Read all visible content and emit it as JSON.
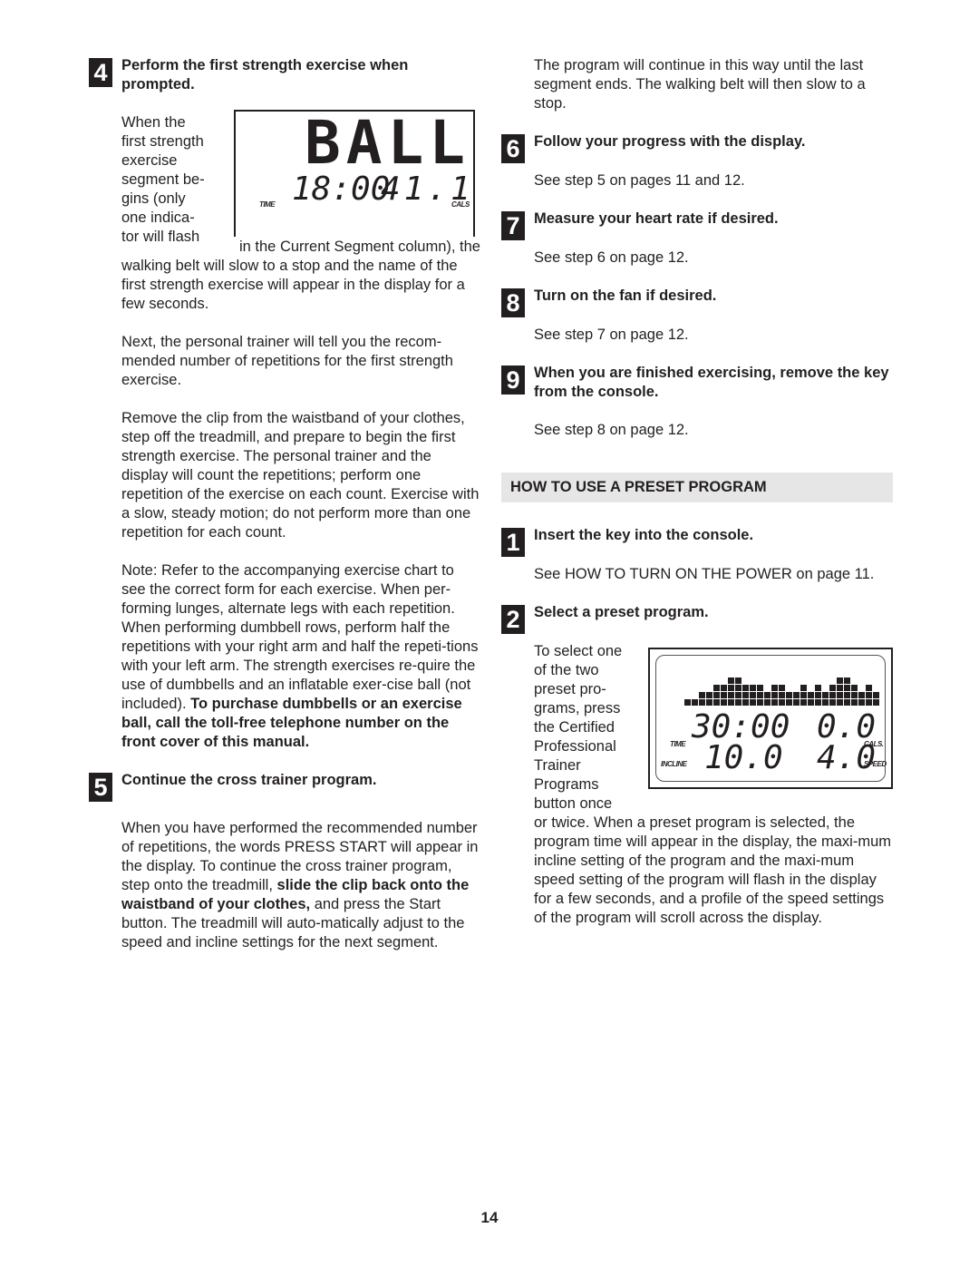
{
  "page_number": "14",
  "left": {
    "step4": {
      "num": "4",
      "heading": "Perform the first strength exercise when prompted.",
      "intro_lines": [
        "When the",
        "first strength",
        "exercise",
        "segment be-",
        "gins (only",
        "one indica-",
        "tor will flash"
      ],
      "intro_rest": "in the Current Segment column), the walking belt will slow to a stop and the name of the first strength exercise will appear in the display for a few seconds.",
      "para2": "Next, the personal trainer will tell you the recom-mended number of repetitions for the first strength exercise.",
      "para3": "Remove the clip from the waistband of your clothes, step off the treadmill, and prepare to begin the first strength exercise. The personal trainer and the display will count the repetitions; perform one repetition of the exercise on each count. Exercise with a slow, steady motion; do not perform more than one repetition for each count.",
      "para4_normal": "Note: Refer to the accompanying exercise chart to see the correct form for each exercise. When per-forming lunges, alternate legs with each repetition. When performing dumbbell rows, perform half the repetitions with your right arm and half the repeti-tions with your left arm. The strength exercises re-quire the use of dumbbells and an inflatable exer-cise ball (not included). ",
      "para4_bold": "To purchase dumbbells or an exercise ball, call the toll-free telephone number on the front cover of this manual.",
      "display": {
        "word": "BALL",
        "time": "18:00",
        "cals": "41.1",
        "time_label": "TIME",
        "cals_label": "CALS"
      }
    },
    "step5": {
      "num": "5",
      "heading": "Continue the cross trainer program.",
      "para_a": "When you have performed the recommended number of repetitions, the words PRESS START will appear in the display. To continue the cross trainer program, step onto the treadmill, ",
      "para_bold": "slide the clip back onto the waistband of your clothes,",
      "para_b": " and press the Start button. The treadmill will auto-matically adjust to the speed and incline settings for the next segment."
    }
  },
  "right": {
    "continuation": "The program will continue in this way until the last segment ends. The walking belt will then slow to a stop.",
    "step6": {
      "num": "6",
      "heading": "Follow your progress with the display.",
      "text": "See step 5 on pages 11 and 12."
    },
    "step7": {
      "num": "7",
      "heading": "Measure your heart rate if desired.",
      "text": "See step 6 on page 12."
    },
    "step8": {
      "num": "8",
      "heading": "Turn on the fan if desired.",
      "text": "See step 7 on page 12."
    },
    "step9": {
      "num": "9",
      "heading": "When you are finished exercising, remove the key from the console.",
      "text": "See step 8 on page 12."
    },
    "section_title": "HOW TO USE A PRESET PROGRAM",
    "p1": {
      "num": "1",
      "heading": "Insert the key into the console.",
      "text": "See HOW TO TURN ON THE POWER on page 11."
    },
    "p2": {
      "num": "2",
      "heading": "Select a preset program.",
      "intro_lines": [
        "To select one",
        "of the two",
        "preset pro-",
        "grams, press",
        "the Certified",
        "Professional",
        "Trainer",
        "Programs",
        "button once"
      ],
      "rest": "or twice. When a preset program is selected, the program time will appear in the display, the maxi-mum incline setting of the program and the maxi-mum speed setting of the program will flash in the display for a few seconds, and a profile of the speed settings of the program will scroll across the display.",
      "display": {
        "time": "30:00",
        "cals": "0.0",
        "incline": "10.0",
        "speed": "4.0",
        "time_label": "TIME",
        "cals_label": "CALS.",
        "incline_label": "INCLINE",
        "speed_label": "SPEED",
        "profile": [
          1,
          1,
          2,
          2,
          3,
          3,
          4,
          4,
          3,
          3,
          3,
          2,
          3,
          3,
          2,
          2,
          3,
          2,
          3,
          2,
          3,
          4,
          4,
          3,
          2,
          3,
          2
        ]
      }
    }
  }
}
